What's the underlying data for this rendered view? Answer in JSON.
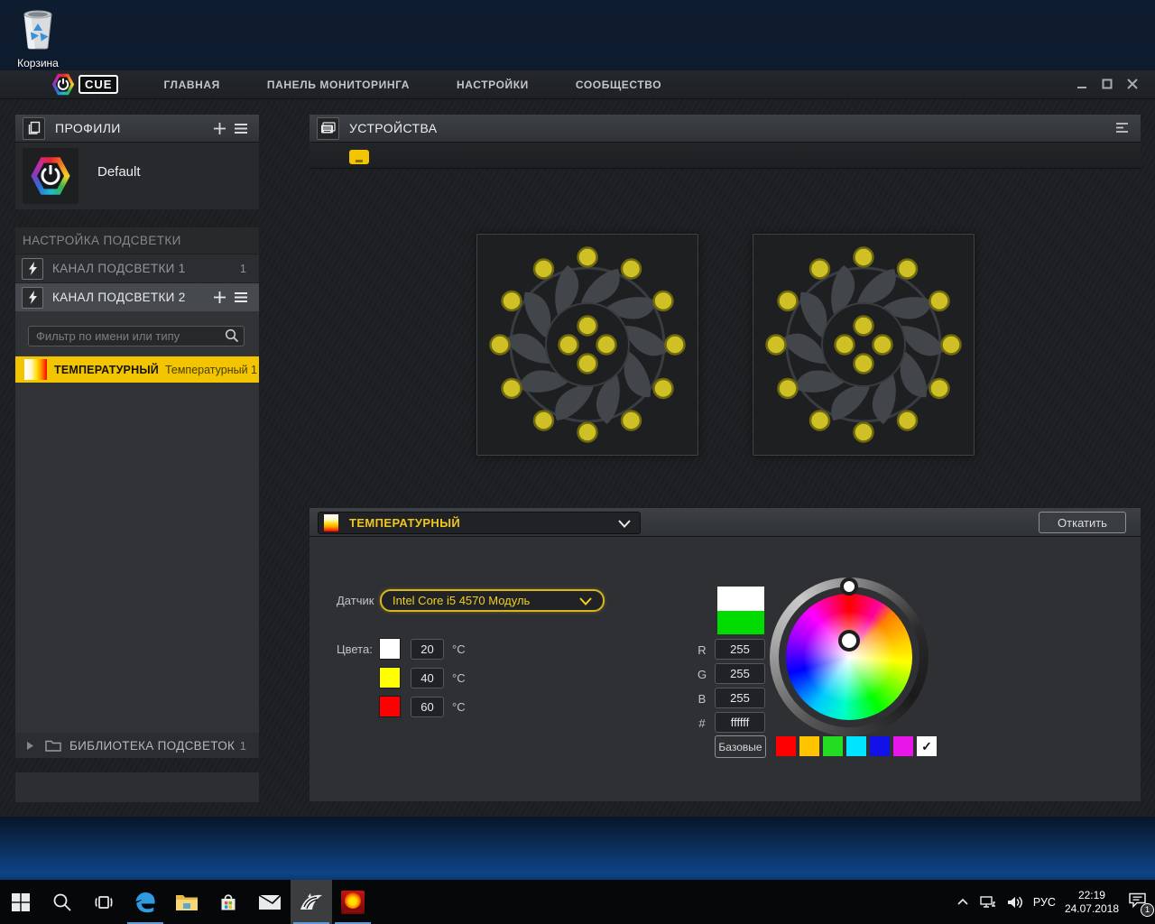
{
  "desktop": {
    "recycle_bin_label": "Корзина"
  },
  "titlebar": {
    "logo_text": "CUE",
    "nav": [
      "ГЛАВНАЯ",
      "ПАНЕЛЬ МОНИТОРИНГА",
      "НАСТРОЙКИ",
      "СООБЩЕСТВО"
    ]
  },
  "sidebar": {
    "profiles": {
      "title": "ПРОФИЛИ",
      "items": [
        {
          "name": "Default"
        }
      ]
    },
    "lighting_setup_title": "НАСТРОЙКА ПОДСВЕТКИ",
    "channels": [
      {
        "label": "КАНАЛ ПОДСВЕТКИ 1",
        "count": "1"
      },
      {
        "label": "КАНАЛ ПОДСВЕТКИ 2"
      }
    ],
    "filter_placeholder": "Фильтр по имени или типу",
    "selected_effect": {
      "type": "ТЕМПЕРАТУРНЫЙ",
      "name": "Температурный 1"
    },
    "library": {
      "label": "БИБЛИОТЕКА ПОДСВЕТОК",
      "count": "1"
    }
  },
  "devices_panel": {
    "title": "УСТРОЙСТВА",
    "fans": {
      "count": 2,
      "led_color": "#cfc125",
      "led_ring": "#6f680f",
      "outer_leds": 12,
      "inner_leds": 4
    }
  },
  "effect_panel": {
    "effect_select": "ТЕМПЕРАТУРНЫЙ",
    "revert_button": "Откатить",
    "sensor_label": "Датчик",
    "sensor_value": "Intel Core i5 4570 Модуль",
    "colors_label": "Цвета:",
    "temp_colors": [
      {
        "color": "#ffffff",
        "temp": "20",
        "unit": "°C"
      },
      {
        "color": "#ffff00",
        "temp": "40",
        "unit": "°C"
      },
      {
        "color": "#ff0000",
        "temp": "60",
        "unit": "°C"
      }
    ],
    "picker": {
      "preview_top": "#ffffff",
      "preview_bottom": "#00dc00",
      "r_label": "R",
      "r": "255",
      "g_label": "G",
      "g": "255",
      "b_label": "B",
      "b": "255",
      "hex_label": "#",
      "hex": "ffffff",
      "basic_label": "Базовые",
      "basic_colors": [
        "#ff0000",
        "#ffc400",
        "#22dd22",
        "#00e5ff",
        "#1212e8",
        "#e816e8",
        "#ffffff"
      ],
      "selected_basic_index": 6,
      "check_glyph": "✓"
    }
  },
  "taskbar": {
    "icons": [
      "start",
      "search",
      "taskview",
      "edge",
      "explorer",
      "store",
      "mail",
      "corsair",
      "flame"
    ],
    "running": {
      "edge": true,
      "corsair": true,
      "flame": true
    },
    "active": "corsair",
    "tray": {
      "language": "РУС",
      "time": "22:19",
      "date": "24.07.2018",
      "badge": "1"
    }
  }
}
